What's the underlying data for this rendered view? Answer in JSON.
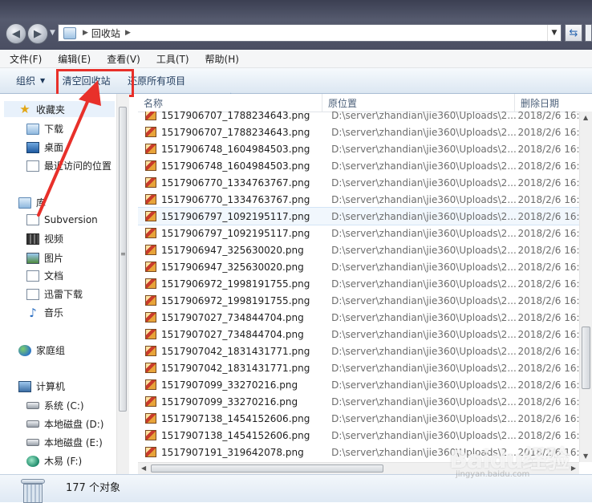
{
  "address": {
    "location": "回收站"
  },
  "menu": [
    "文件(F)",
    "编辑(E)",
    "查看(V)",
    "工具(T)",
    "帮助(H)"
  ],
  "toolbar": {
    "organize": "组织",
    "empty_bin": "清空回收站",
    "restore_all": "还原所有项目"
  },
  "nav": {
    "favorites": "收藏夹",
    "downloads": "下载",
    "desktop": "桌面",
    "recent": "最近访问的位置",
    "libraries": "库",
    "subversion": "Subversion",
    "videos": "视频",
    "pictures": "图片",
    "documents": "文档",
    "thunder": "迅雷下载",
    "music": "音乐",
    "homegroup": "家庭组",
    "computer": "计算机",
    "drive_c": "系统 (C:)",
    "drive_d": "本地磁盘 (D:)",
    "drive_e": "本地磁盘 (E:)",
    "drive_f": "木易 (F:)"
  },
  "columns": {
    "name": "名称",
    "original": "原位置",
    "deleted": "删除日期"
  },
  "files": [
    {
      "name": "1517906707_1788234643.png",
      "orig": "D:\\server\\zhandian\\jie360\\Uploads\\2...",
      "date": "2018/2/6 16:"
    },
    {
      "name": "1517906707_1788234643.png",
      "orig": "D:\\server\\zhandian\\jie360\\Uploads\\2...",
      "date": "2018/2/6 16:"
    },
    {
      "name": "1517906748_1604984503.png",
      "orig": "D:\\server\\zhandian\\jie360\\Uploads\\2...",
      "date": "2018/2/6 16:"
    },
    {
      "name": "1517906748_1604984503.png",
      "orig": "D:\\server\\zhandian\\jie360\\Uploads\\2...",
      "date": "2018/2/6 16:"
    },
    {
      "name": "1517906770_1334763767.png",
      "orig": "D:\\server\\zhandian\\jie360\\Uploads\\2...",
      "date": "2018/2/6 16:"
    },
    {
      "name": "1517906770_1334763767.png",
      "orig": "D:\\server\\zhandian\\jie360\\Uploads\\2...",
      "date": "2018/2/6 16:"
    },
    {
      "name": "1517906797_1092195117.png",
      "orig": "D:\\server\\zhandian\\jie360\\Uploads\\2...",
      "date": "2018/2/6 16:"
    },
    {
      "name": "1517906797_1092195117.png",
      "orig": "D:\\server\\zhandian\\jie360\\Uploads\\2...",
      "date": "2018/2/6 16:"
    },
    {
      "name": "1517906947_325630020.png",
      "orig": "D:\\server\\zhandian\\jie360\\Uploads\\2...",
      "date": "2018/2/6 16:"
    },
    {
      "name": "1517906947_325630020.png",
      "orig": "D:\\server\\zhandian\\jie360\\Uploads\\2...",
      "date": "2018/2/6 16:"
    },
    {
      "name": "1517906972_1998191755.png",
      "orig": "D:\\server\\zhandian\\jie360\\Uploads\\2...",
      "date": "2018/2/6 16:"
    },
    {
      "name": "1517906972_1998191755.png",
      "orig": "D:\\server\\zhandian\\jie360\\Uploads\\2...",
      "date": "2018/2/6 16:"
    },
    {
      "name": "1517907027_734844704.png",
      "orig": "D:\\server\\zhandian\\jie360\\Uploads\\2...",
      "date": "2018/2/6 16:"
    },
    {
      "name": "1517907027_734844704.png",
      "orig": "D:\\server\\zhandian\\jie360\\Uploads\\2...",
      "date": "2018/2/6 16:"
    },
    {
      "name": "1517907042_1831431771.png",
      "orig": "D:\\server\\zhandian\\jie360\\Uploads\\2...",
      "date": "2018/2/6 16:"
    },
    {
      "name": "1517907042_1831431771.png",
      "orig": "D:\\server\\zhandian\\jie360\\Uploads\\2...",
      "date": "2018/2/6 16:"
    },
    {
      "name": "1517907099_33270216.png",
      "orig": "D:\\server\\zhandian\\jie360\\Uploads\\2...",
      "date": "2018/2/6 16:"
    },
    {
      "name": "1517907099_33270216.png",
      "orig": "D:\\server\\zhandian\\jie360\\Uploads\\2...",
      "date": "2018/2/6 16:"
    },
    {
      "name": "1517907138_1454152606.png",
      "orig": "D:\\server\\zhandian\\jie360\\Uploads\\2...",
      "date": "2018/2/6 16:"
    },
    {
      "name": "1517907138_1454152606.png",
      "orig": "D:\\server\\zhandian\\jie360\\Uploads\\2...",
      "date": "2018/2/6 16:"
    },
    {
      "name": "1517907191_319642078.png",
      "orig": "D:\\server\\zhandian\\jie360\\Uploads\\2...",
      "date": "2018/2/6 16:"
    }
  ],
  "selected_row": 6,
  "status": {
    "count": "177 个对象"
  },
  "watermark": {
    "brand": "Baidu经验",
    "url": "jingyan.baidu.com"
  },
  "colors": {
    "highlight": "#e8302a",
    "toolbar_text": "#1e395b"
  }
}
